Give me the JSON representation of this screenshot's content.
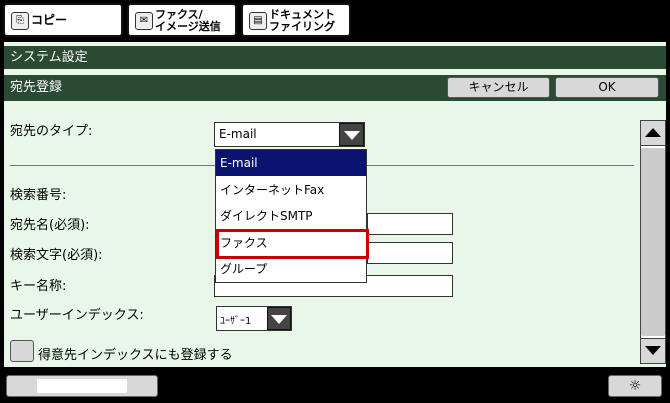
{
  "tabs": [
    {
      "label": "コピー",
      "icon": "copy-icon"
    },
    {
      "label": "ファクス/\nイメージ送信",
      "icon": "fax-icon"
    },
    {
      "label": "ドキュメント\nファイリング",
      "icon": "document-filing-icon"
    }
  ],
  "header": {
    "system_settings": "システム設定",
    "section": "宛先登録"
  },
  "buttons": {
    "cancel": "キャンセル",
    "ok": "OK"
  },
  "form": {
    "type_label": "宛先のタイプ:",
    "type_value": "E-mail",
    "search_no": "検索番号:",
    "dest_name": "宛先名(必須):",
    "search_char": "検索文字(必須):",
    "key_name": "キー名称:",
    "user_index": "ユーザーインデックス:",
    "user_index_value": "ﾕｰｻﾞｰ1",
    "favorite_checkbox": "得意先インデックスにも登録する"
  },
  "dropdown_options": [
    "E-mail",
    "インターネットFax",
    "ダイレクトSMTP",
    "ファクス",
    "グループ"
  ],
  "colors": {
    "header_bg": "#2a4a34",
    "selected_option": "#0a1470",
    "highlight_box": "#cc0000",
    "panel_bg": "#e8f7e8"
  }
}
